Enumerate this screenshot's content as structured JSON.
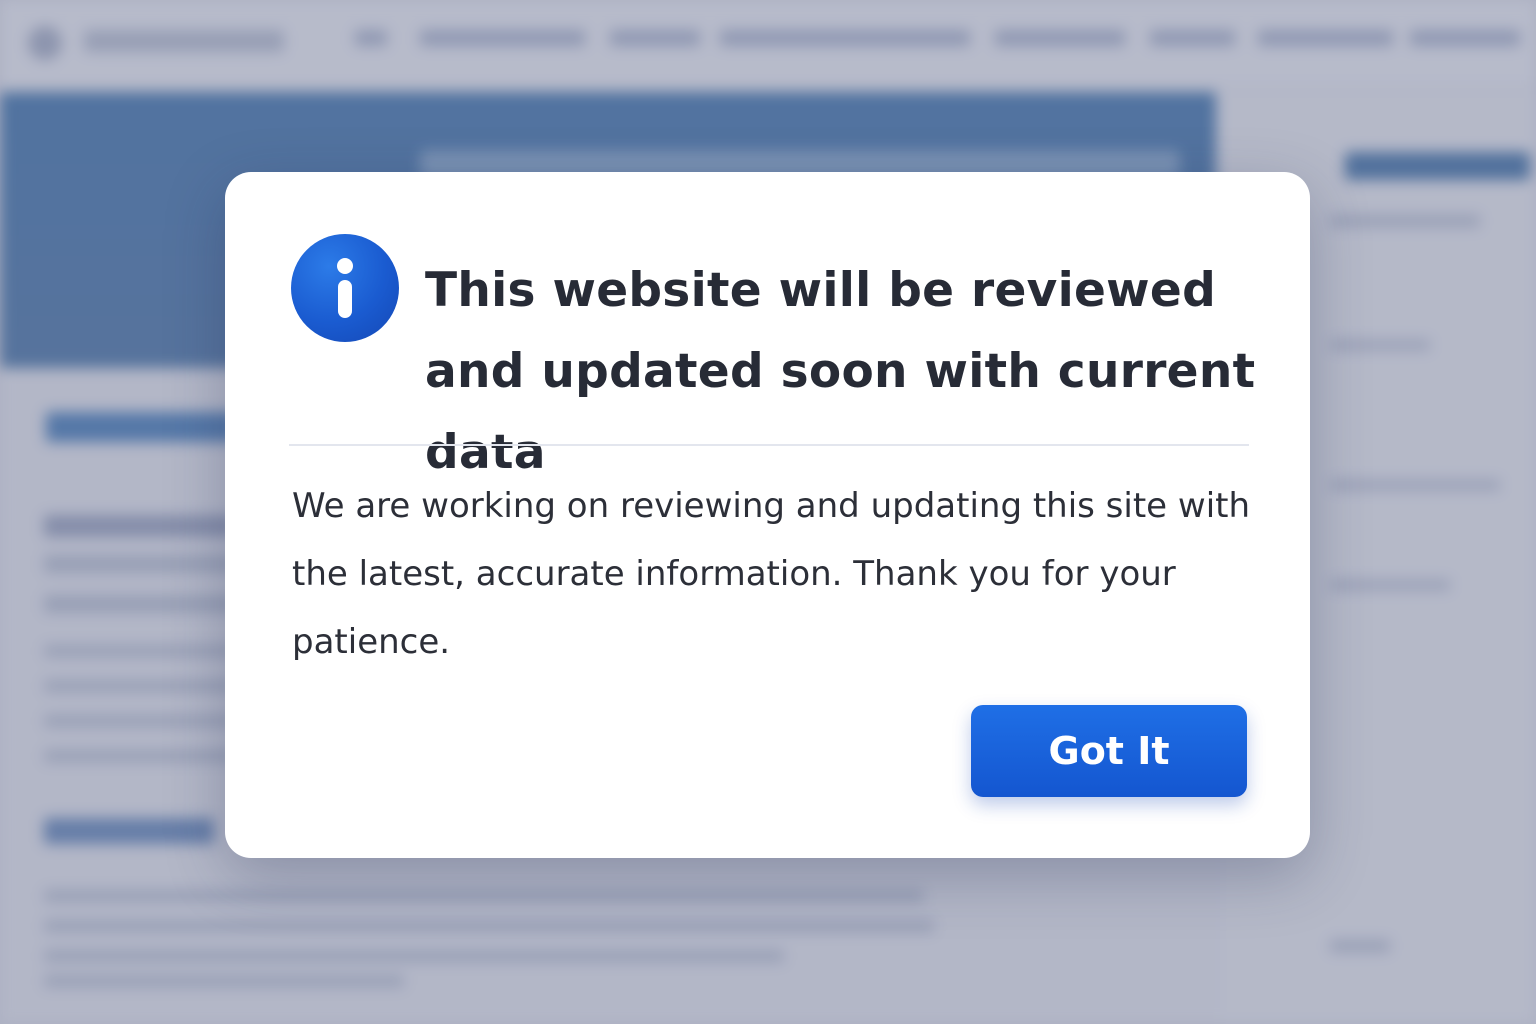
{
  "dialog": {
    "icon": "info-icon",
    "title": "This website will be reviewed and updated soon with current data",
    "message": "We are working on reviewing and updating this site with the latest, accurate information. Thank you for your patience.",
    "button_label": "Got It"
  },
  "colors": {
    "accent": "#1a5bd0",
    "button": "#1a63dd",
    "title_text": "#272b36",
    "body_text": "#2c2f38",
    "hero_background": "#2d5e97"
  }
}
